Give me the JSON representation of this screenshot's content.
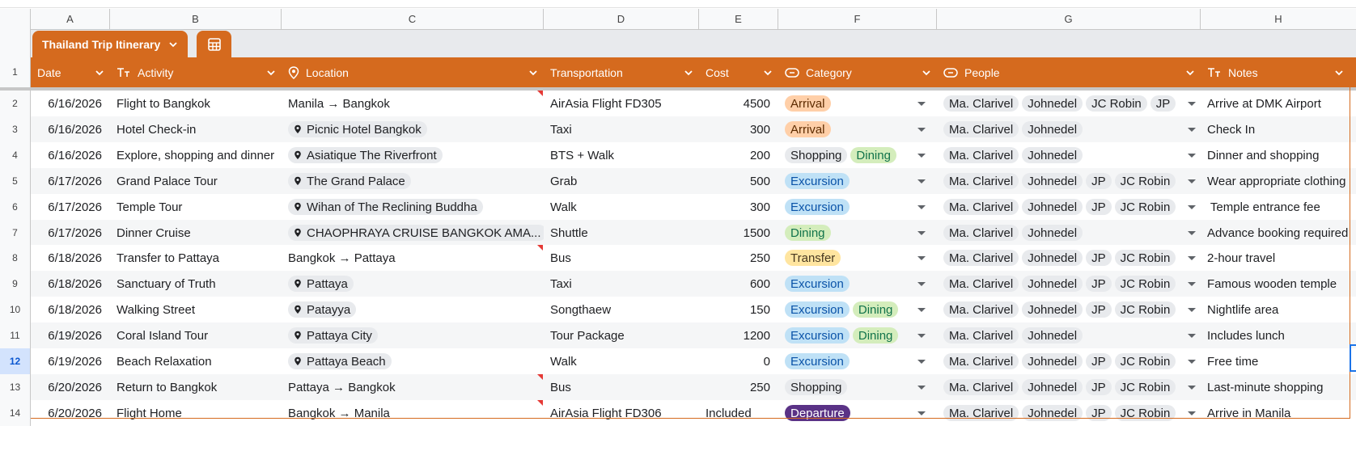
{
  "columns": [
    "A",
    "B",
    "C",
    "D",
    "E",
    "F",
    "G",
    "H"
  ],
  "table": {
    "name": "Thailand Trip Itinerary",
    "headers": {
      "date": "Date",
      "activity": "Activity",
      "location": "Location",
      "transportation": "Transportation",
      "cost": "Cost",
      "category": "Category",
      "people": "People",
      "notes": "Notes"
    }
  },
  "row_numbers": [
    "1",
    "2",
    "3",
    "4",
    "5",
    "6",
    "7",
    "8",
    "9",
    "10",
    "11",
    "12",
    "13",
    "14"
  ],
  "category_colors": {
    "Arrival": {
      "bg": "#ffcfa8",
      "fg": "#5c2b00"
    },
    "Shopping": {
      "bg": "#e8eaed",
      "fg": "#202124"
    },
    "Dining": {
      "bg": "#d4edbc",
      "fg": "#11734b"
    },
    "Excursion": {
      "bg": "#bfe1f6",
      "fg": "#0a53a8"
    },
    "Transfer": {
      "bg": "#ffe5a0",
      "fg": "#473821"
    },
    "Departure": {
      "bg": "#5a3286",
      "fg": "#ffffff"
    }
  },
  "theme": {
    "table_header": "#d56a1e",
    "selected_row": "#d3e3fd"
  },
  "rows": [
    {
      "date": "6/16/2026",
      "activity": "Flight to Bangkok",
      "location": "Manila → Bangkok",
      "location_chip": false,
      "note_flag": true,
      "transportation": "AirAsia Flight FD305",
      "cost": "4500",
      "category": [
        "Arrival"
      ],
      "people": [
        "Ma. Clarivel",
        "Johnedel",
        "JC Robin",
        "JP"
      ],
      "notes": "Arrive at DMK Airport"
    },
    {
      "date": "6/16/2026",
      "activity": "Hotel Check-in",
      "location": "Picnic Hotel Bangkok",
      "location_chip": true,
      "note_flag": false,
      "transportation": "Taxi",
      "cost": "300",
      "category": [
        "Arrival"
      ],
      "people": [
        "Ma. Clarivel",
        "Johnedel"
      ],
      "notes": "Check In"
    },
    {
      "date": "6/16/2026",
      "activity": "Explore, shopping and dinner",
      "location": "Asiatique The Riverfront",
      "location_chip": true,
      "note_flag": false,
      "transportation": "BTS + Walk",
      "cost": "200",
      "category": [
        "Shopping",
        "Dining"
      ],
      "people": [
        "Ma. Clarivel",
        "Johnedel"
      ],
      "notes": "Dinner and shopping"
    },
    {
      "date": "6/17/2026",
      "activity": "Grand Palace Tour",
      "location": "The Grand Palace",
      "location_chip": true,
      "note_flag": false,
      "transportation": "Grab",
      "cost": "500",
      "category": [
        "Excursion"
      ],
      "people": [
        "Ma. Clarivel",
        "Johnedel",
        "JP",
        "JC Robin"
      ],
      "notes": "Wear appropriate clothing"
    },
    {
      "date": "6/17/2026",
      "activity": "Temple Tour",
      "location": "Wihan of The Reclining Buddha",
      "location_chip": true,
      "note_flag": false,
      "transportation": "Walk",
      "cost": "300",
      "category": [
        "Excursion"
      ],
      "people": [
        "Ma. Clarivel",
        "Johnedel",
        "JP",
        "JC Robin"
      ],
      "notes": " Temple entrance fee"
    },
    {
      "date": "6/17/2026",
      "activity": "Dinner Cruise",
      "location": "CHAOPHRAYA CRUISE BANGKOK AMA...",
      "location_chip": true,
      "note_flag": false,
      "transportation": "Shuttle",
      "cost": "1500",
      "category": [
        "Dining"
      ],
      "people": [
        "Ma. Clarivel",
        "Johnedel"
      ],
      "notes": "Advance booking required"
    },
    {
      "date": "6/18/2026",
      "activity": "Transfer to Pattaya",
      "location": "Bangkok → Pattaya",
      "location_chip": false,
      "note_flag": true,
      "transportation": "Bus",
      "cost": "250",
      "category": [
        "Transfer"
      ],
      "people": [
        "Ma. Clarivel",
        "Johnedel",
        "JP",
        "JC Robin"
      ],
      "notes": "2-hour travel"
    },
    {
      "date": "6/18/2026",
      "activity": "Sanctuary of Truth",
      "location": "Pattaya",
      "location_chip": true,
      "note_flag": false,
      "transportation": "Taxi",
      "cost": "600",
      "category": [
        "Excursion"
      ],
      "people": [
        "Ma. Clarivel",
        "Johnedel",
        "JP",
        "JC Robin"
      ],
      "notes": "Famous wooden temple"
    },
    {
      "date": "6/18/2026",
      "activity": "Walking Street",
      "location": "Patayya",
      "location_chip": true,
      "note_flag": false,
      "transportation": "Songthaew",
      "cost": "150",
      "category": [
        "Excursion",
        "Dining"
      ],
      "people": [
        "Ma. Clarivel",
        "Johnedel",
        "JP",
        "JC Robin"
      ],
      "notes": "Nightlife area"
    },
    {
      "date": "6/19/2026",
      "activity": "Coral Island Tour",
      "location": "Pattaya City",
      "location_chip": true,
      "note_flag": false,
      "transportation": "Tour Package",
      "cost": "1200",
      "category": [
        "Excursion",
        "Dining"
      ],
      "people": [
        "Ma. Clarivel",
        "Johnedel"
      ],
      "notes": "Includes lunch"
    },
    {
      "date": "6/19/2026",
      "activity": "Beach Relaxation",
      "location": "Pattaya Beach",
      "location_chip": true,
      "note_flag": false,
      "transportation": "Walk",
      "cost": "0",
      "category": [
        "Excursion"
      ],
      "people": [
        "Ma. Clarivel",
        "Johnedel",
        "JP",
        "JC Robin"
      ],
      "notes": "Free time"
    },
    {
      "date": "6/20/2026",
      "activity": "Return to Bangkok",
      "location": "Pattaya → Bangkok",
      "location_chip": false,
      "note_flag": true,
      "transportation": "Bus",
      "cost": "250",
      "category": [
        "Shopping"
      ],
      "people": [
        "Ma. Clarivel",
        "Johnedel",
        "JP",
        "JC Robin"
      ],
      "notes": "Last-minute shopping"
    },
    {
      "date": "6/20/2026",
      "activity": "Flight Home",
      "location": "Bangkok → Manila",
      "location_chip": false,
      "note_flag": true,
      "transportation": "AirAsia Flight FD306",
      "cost": "Included",
      "category": [
        "Departure"
      ],
      "people": [
        "Ma. Clarivel",
        "Johnedel",
        "JP",
        "JC Robin"
      ],
      "notes": "Arrive in Manila"
    }
  ]
}
